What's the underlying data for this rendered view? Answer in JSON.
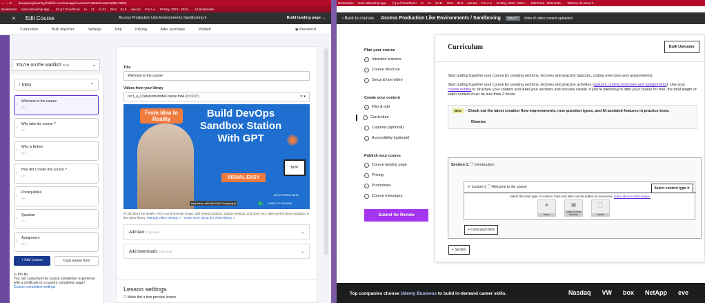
{
  "left": {
    "address": "devopsengineering.thinkific.com/manage/courses/2748666/contents/85179843",
    "bookmarks": [
      "Bookmarks",
      "mais citizenship app...",
      "(?) p-f CloudGuru",
      "IA",
      "s1",
      "s1.31",
      "05.8",
      "01.8",
      "usa tax",
      "F.N.A.A",
      "10 May, 2024 - 2024...",
      "All Bookmarks"
    ],
    "edit_course": "Edit Course",
    "course_title": "Access Production Like Environments Sandboxing",
    "build_landing": "Build landing page →",
    "tabs": [
      "Curriculum",
      "Bulk importer",
      "Settings",
      "Drip",
      "Pricing",
      "After purchase",
      "Publish"
    ],
    "preview": "Preview",
    "waitlist": "You're on the waitlist!",
    "waitlist_badge": "Draft",
    "intro": "Intro",
    "lessons": [
      {
        "title": "Welcome to the course",
        "sub": "CH"
      },
      {
        "title": "Why take the course ?",
        "sub": "CH"
      },
      {
        "title": "Who is Erdem",
        "sub": "CH"
      },
      {
        "title": "How did I create this course ?",
        "sub": "CH"
      },
      {
        "title": "Prerequisites",
        "sub": "CH"
      },
      {
        "title": "Question",
        "sub": "CH"
      },
      {
        "title": "Assignment",
        "sub": "CH"
      }
    ],
    "add_lesson": "+ Add Lesson",
    "copy_lesson": "Copy lesson from",
    "pro_tip_title": "Pro tip",
    "pro_tip_text": "You can customize the course completion experience with a certificate or a custom completion page!",
    "pro_tip_link": "Course completion settings",
    "title_label": "Title",
    "title_value": "Welcome to the course",
    "video_label": "Videos from your library",
    "video_value": "orc1_a_v1WelcometotheCourse.mp4 (0:01:07)",
    "thumb_badge": "From Idea to Reality",
    "thumb_heading": "Build DevOps Sandbox Station With GPT",
    "thumb_pill": "VISUAL EASY",
    "thumb_caption": "Hey there, with this MVP I'm going to",
    "thumb_name": "BEYAT ERDEM SAHIN",
    "thumb_platform": "UDEMY ON DEMAND",
    "details_text": "It's all about the details. Pick your thumbnail image, add closed captions, update settings, and track your video performance analytics in the video library.",
    "details_link1": "Manage video settings ↗",
    "details_link2": "Learn more about the Video library ↗",
    "add_text": "Add text",
    "add_text_opt": "(Optional)",
    "add_downloads": "Add downloads",
    "add_downloads_opt": "(Optional)",
    "lesson_settings": "Lesson settings",
    "free_preview": "Make this a free preview lesson"
  },
  "right": {
    "back": "Back to courses",
    "course_title": "Access Production Like Environments / Sandboxing",
    "draft": "DRAFT",
    "minutes": "0min of video content uploaded",
    "bookmarks": [
      "Bookmarks",
      "mais citizenship app...",
      "(?) p-f CloudGuru",
      "IA",
      "s1",
      "s1.31",
      "05.8",
      "01.8",
      "usa tax",
      "F.N.A.A",
      "10 May, 2024 - 2024...",
      "Edit Pack - Rifat Erde...",
      "What to do when li..."
    ],
    "plan_title": "Plan your course",
    "plan": [
      {
        "label": "Intended learners",
        "done": true
      },
      {
        "label": "Course structure",
        "done": true
      },
      {
        "label": "Setup & test video",
        "done": false
      }
    ],
    "create_title": "Create your content",
    "create": [
      {
        "label": "Film & edit",
        "done": true
      },
      {
        "label": "Curriculum",
        "done": false,
        "current": true
      },
      {
        "label": "Captions (optional)",
        "done": false
      },
      {
        "label": "Accessibility (optional)",
        "done": false
      }
    ],
    "publish_title": "Publish your course",
    "publish": [
      {
        "label": "Course landing page",
        "done": false
      },
      {
        "label": "Pricing",
        "done": false
      },
      {
        "label": "Promotions",
        "done": true
      },
      {
        "label": "Course messages",
        "done": false
      }
    ],
    "submit": "Submit for Review",
    "curriculum": "Curriculum",
    "bulk_uploader": "Bulk Uploader",
    "intro_text1": "Start putting together your course by creating sections, lectures and practice (quizzes, coding exercises and assignments).",
    "intro_text2a": "Start putting together your course by creating sections, lectures and practice activities (",
    "intro_text2link": "quizzes, coding exercises and assignments",
    "intro_text2b": "). Use your",
    "intro_text2link2": "course outline",
    "intro_text2c": "to structure your content and label your sections and lectures clearly. If you're intending to offer your course for free, the total length of video content must be less than 2 hours.",
    "beta": "Beta",
    "beta_text": "Check out the latest creation flow improvements, new question types, and AI-assisted features in practice tests.",
    "dismiss": "Dismiss",
    "section_label": "Section 1:",
    "section_title": "Introduction",
    "lecture_label": "Lecture 1:",
    "lecture_title": "Welcome to the course",
    "select_type": "Select content type",
    "main_type_text": "Select the main type of content. Files and links can be added as resources.",
    "main_type_link": "Learn about content types.",
    "types": [
      "Video",
      "Video & Slide Mashup",
      "Article"
    ],
    "curriculum_item": "+ Curriculum item",
    "add_section": "+ Section",
    "footer_text_a": "Top companies choose",
    "footer_brand": "Udemy Business",
    "footer_text_b": "to build in-demand career skills.",
    "logos": [
      "Nasdaq",
      "VW",
      "box",
      "NetApp",
      "eve"
    ]
  }
}
